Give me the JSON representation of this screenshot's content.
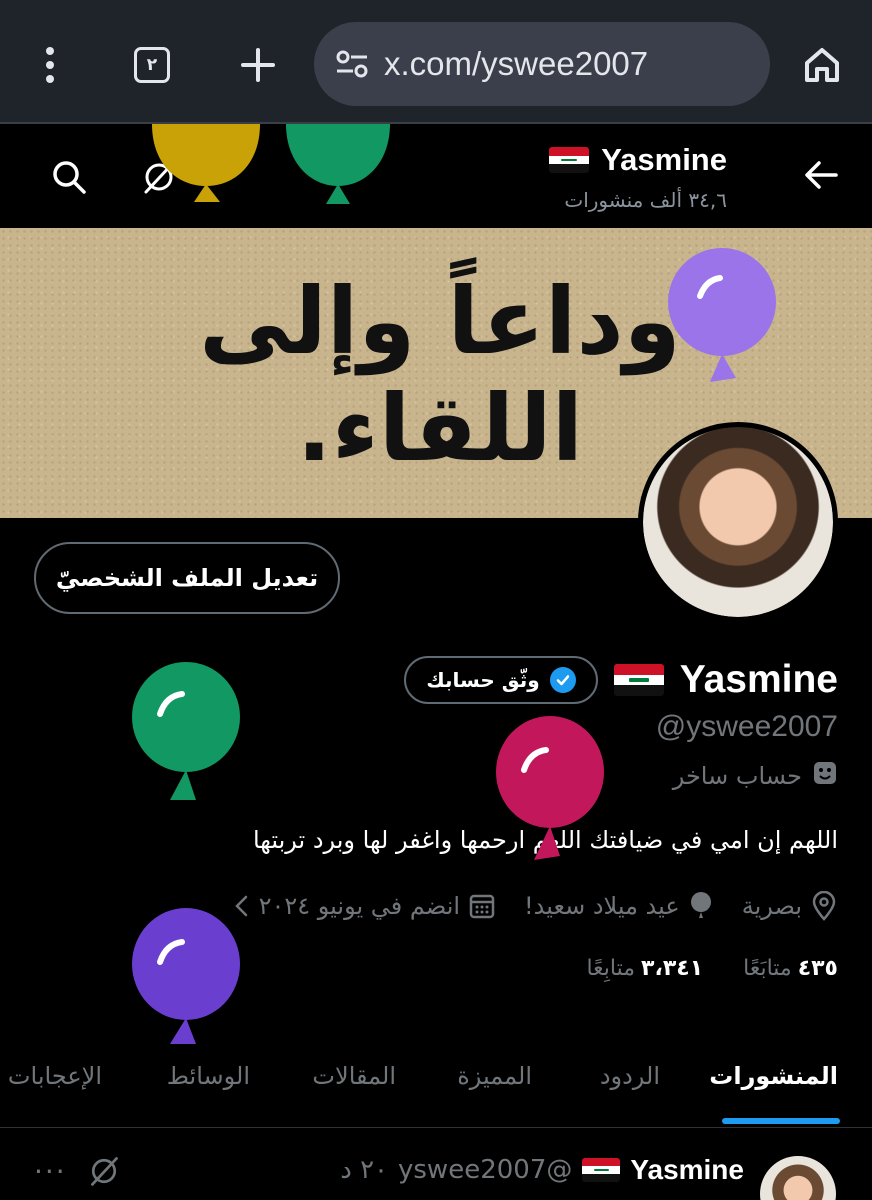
{
  "browser": {
    "tab_count": "٢",
    "url": "x.com/yswee2007"
  },
  "topbar": {
    "name": "Yasmine",
    "post_count": "٣٤,٦ ألف منشورات"
  },
  "banner": {
    "text": "وداعاً وإلى اللقاء."
  },
  "profile": {
    "edit_button": "تعديل الملف الشخصيّ",
    "name": "Yasmine",
    "verify_button": "وثّق حسابك",
    "handle": "@yswee2007",
    "parody_label": "حساب ساخر",
    "bio": "اللهم إن امي في ضيافتك اللهم ارحمها واغفر لها وبرد تربتها",
    "location": "بصرية",
    "birthday": "عيد ميلاد سعيد!",
    "joined": "انضم في يونيو ٢٠٢٤",
    "following_count": "٤٣٥",
    "following_label": "متابَعًا",
    "followers_count": "٣،٣٤١",
    "followers_label": "متابِعًا"
  },
  "tabs": [
    "المنشورات",
    "الردود",
    "المميزة",
    "المقالات",
    "الوسائط",
    "الإعجابات"
  ],
  "post": {
    "name": "Yasmine",
    "handle": "@yswee2007",
    "time": "٢٠ د",
    "more": "···"
  },
  "icons": {
    "more": "more-vertical-icon",
    "home": "home-icon",
    "search": "search-icon",
    "grok": "grok-icon",
    "back": "back-arrow-icon"
  },
  "colors": {
    "accent": "#1d9bf0",
    "balloon_yellow": "#c9a208",
    "balloon_green": "#129863",
    "balloon_lavender": "#9a74e8",
    "balloon_pink": "#c2185b",
    "balloon_purple": "#6a3fd0"
  }
}
